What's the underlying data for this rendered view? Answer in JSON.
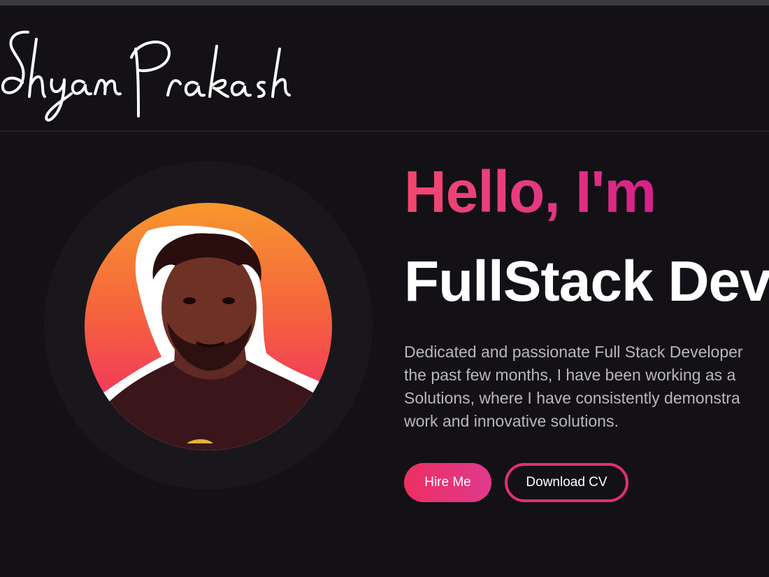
{
  "header": {
    "logo_text": "Shyam Prakash"
  },
  "hero": {
    "greeting": "Hello, I'm",
    "role": "FullStack Dev",
    "bio_lines": [
      "Dedicated and passionate Full Stack Developer",
      "the past few months, I have been working as a",
      "Solutions, where I have consistently demonstra",
      "work and innovative solutions."
    ],
    "hire_label": "Hire Me",
    "cv_label": "Download CV"
  },
  "colors": {
    "background": "#131115",
    "accent_pink": "#e73c7e",
    "avatar_gradient_top": "#f7972e",
    "avatar_gradient_bottom": "#ef1f70"
  },
  "icons": {
    "profile_photo": "portrait-photo"
  }
}
